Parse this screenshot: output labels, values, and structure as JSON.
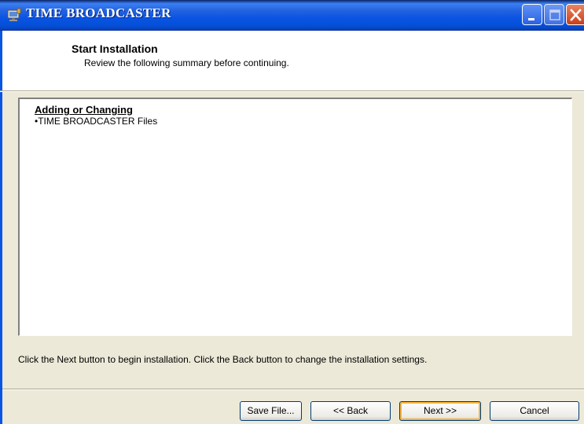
{
  "window": {
    "title": "TIME BROADCASTER",
    "app_icon": "installer-icon",
    "controls": [
      "minimize-icon",
      "maximize-icon",
      "close-icon"
    ]
  },
  "header": {
    "title": "Start Installation",
    "subtitle": "Review the following summary before continuing."
  },
  "summary": {
    "heading": "Adding or Changing",
    "items": [
      "•TIME BROADCASTER Files"
    ]
  },
  "instruction": "Click the Next button to begin installation.  Click the Back button to change the installation settings.",
  "buttons": {
    "save": "Save File...",
    "back": "<< Back",
    "next": "Next >>",
    "cancel": "Cancel"
  },
  "colors": {
    "titlebar": "#0a54e3",
    "dialog_bg": "#ece9d8",
    "focus_ring": "#f8b33a",
    "close_button": "#c8401c"
  }
}
